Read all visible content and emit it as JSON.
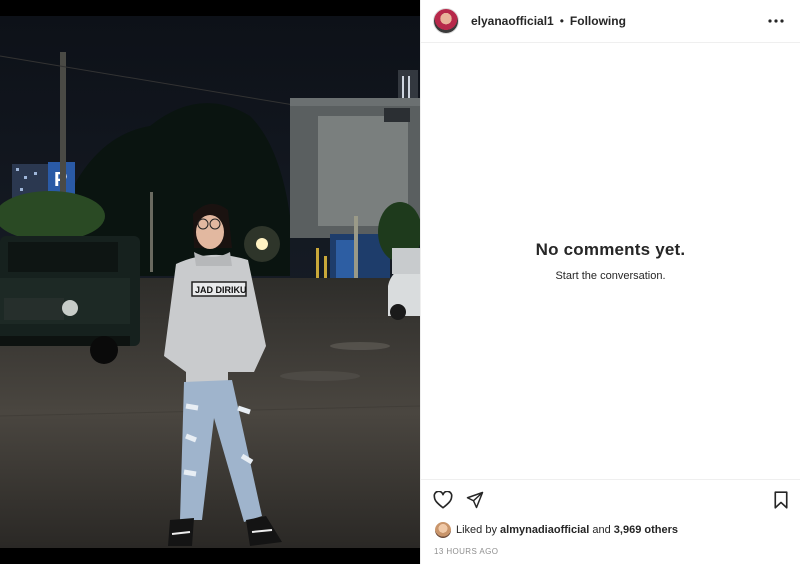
{
  "post": {
    "username": "elyanaofficial1",
    "separator": "•",
    "follow_status": "Following",
    "hoodie_text": "JAD DIRIKU"
  },
  "comments": {
    "empty_title": "No comments yet.",
    "empty_subtitle": "Start the conversation."
  },
  "likes": {
    "prefix": "Liked by",
    "liked_by_user": "almynadiaofficial",
    "and_text": "and",
    "others_count": "3,969 others"
  },
  "timestamp": "13 HOURS AGO",
  "icons": {
    "more": "more-horizontal-icon",
    "like": "heart-icon",
    "share": "paper-plane-icon",
    "save": "bookmark-icon"
  },
  "colors": {
    "text": "#262626",
    "muted": "#8e8e8e",
    "divider": "#efefef"
  }
}
